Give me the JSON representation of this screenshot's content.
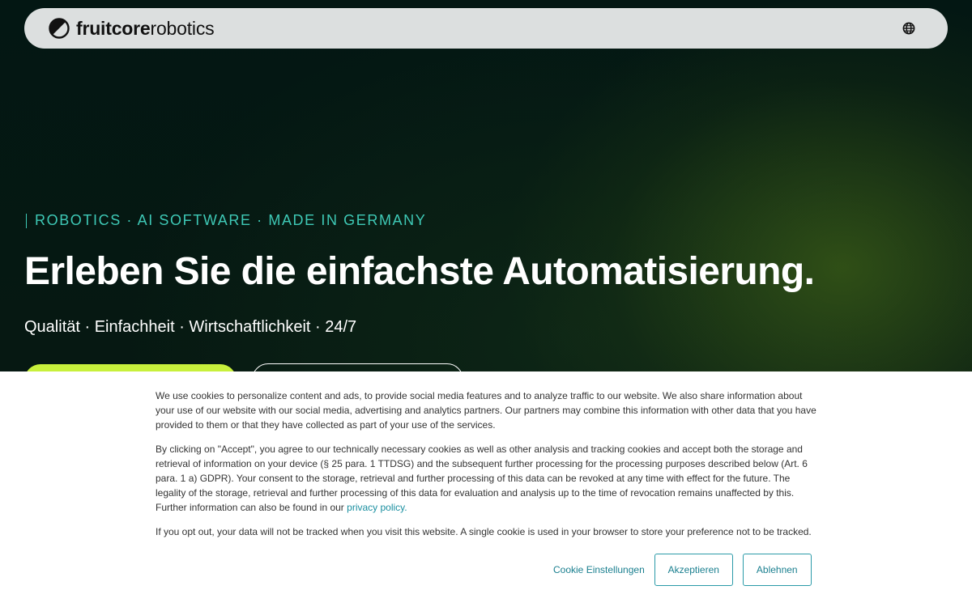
{
  "brand": {
    "name_bold": "fruitcore",
    "name_light": "robotics"
  },
  "nav": {
    "language_icon": "globe-icon"
  },
  "hero": {
    "tagline": "ROBOTICS · AI SOFTWARE · MADE IN GERMANY",
    "headline": "Erleben Sie die einfachste Automatisierung.",
    "subline": "Qualität · Einfachheit · Wirtschaftlichkeit · 24/7"
  },
  "colors": {
    "accent_teal": "#3ec9b6",
    "accent_lime": "#c8f03c",
    "link_teal": "#1a8fa0",
    "background_dark": "#04120f"
  },
  "cookie": {
    "paragraph1": "We use cookies to personalize content and ads, to provide social media features and to analyze traffic to our website. We also share information about your use of our website with our social media, advertising and analytics partners. Our partners may combine this information with other data that you have provided to them or that they have collected as part of your use of the services.",
    "paragraph2": "By clicking on \"Accept\", you agree to our technically necessary cookies as well as other analysis and tracking cookies and accept both the storage and retrieval of information on your device (§ 25 para. 1 TTDSG) and the subsequent further processing for the processing purposes described below (Art. 6 para. 1 a) GDPR). Your consent to the storage, retrieval and further processing of this data can be revoked at any time with effect for the future. The legality of the storage, retrieval and further processing of this data for evaluation and analysis up to the time of revocation remains unaffected by this. Further information can also be found in our",
    "privacy_link": "privacy policy.",
    "paragraph3": "If you opt out, your data will not be tracked when you visit this website. A single cookie is used in your browser to store your preference not to be tracked.",
    "settings_label": "Cookie Einstellungen",
    "accept_label": "Akzeptieren",
    "decline_label": "Ablehnen"
  }
}
